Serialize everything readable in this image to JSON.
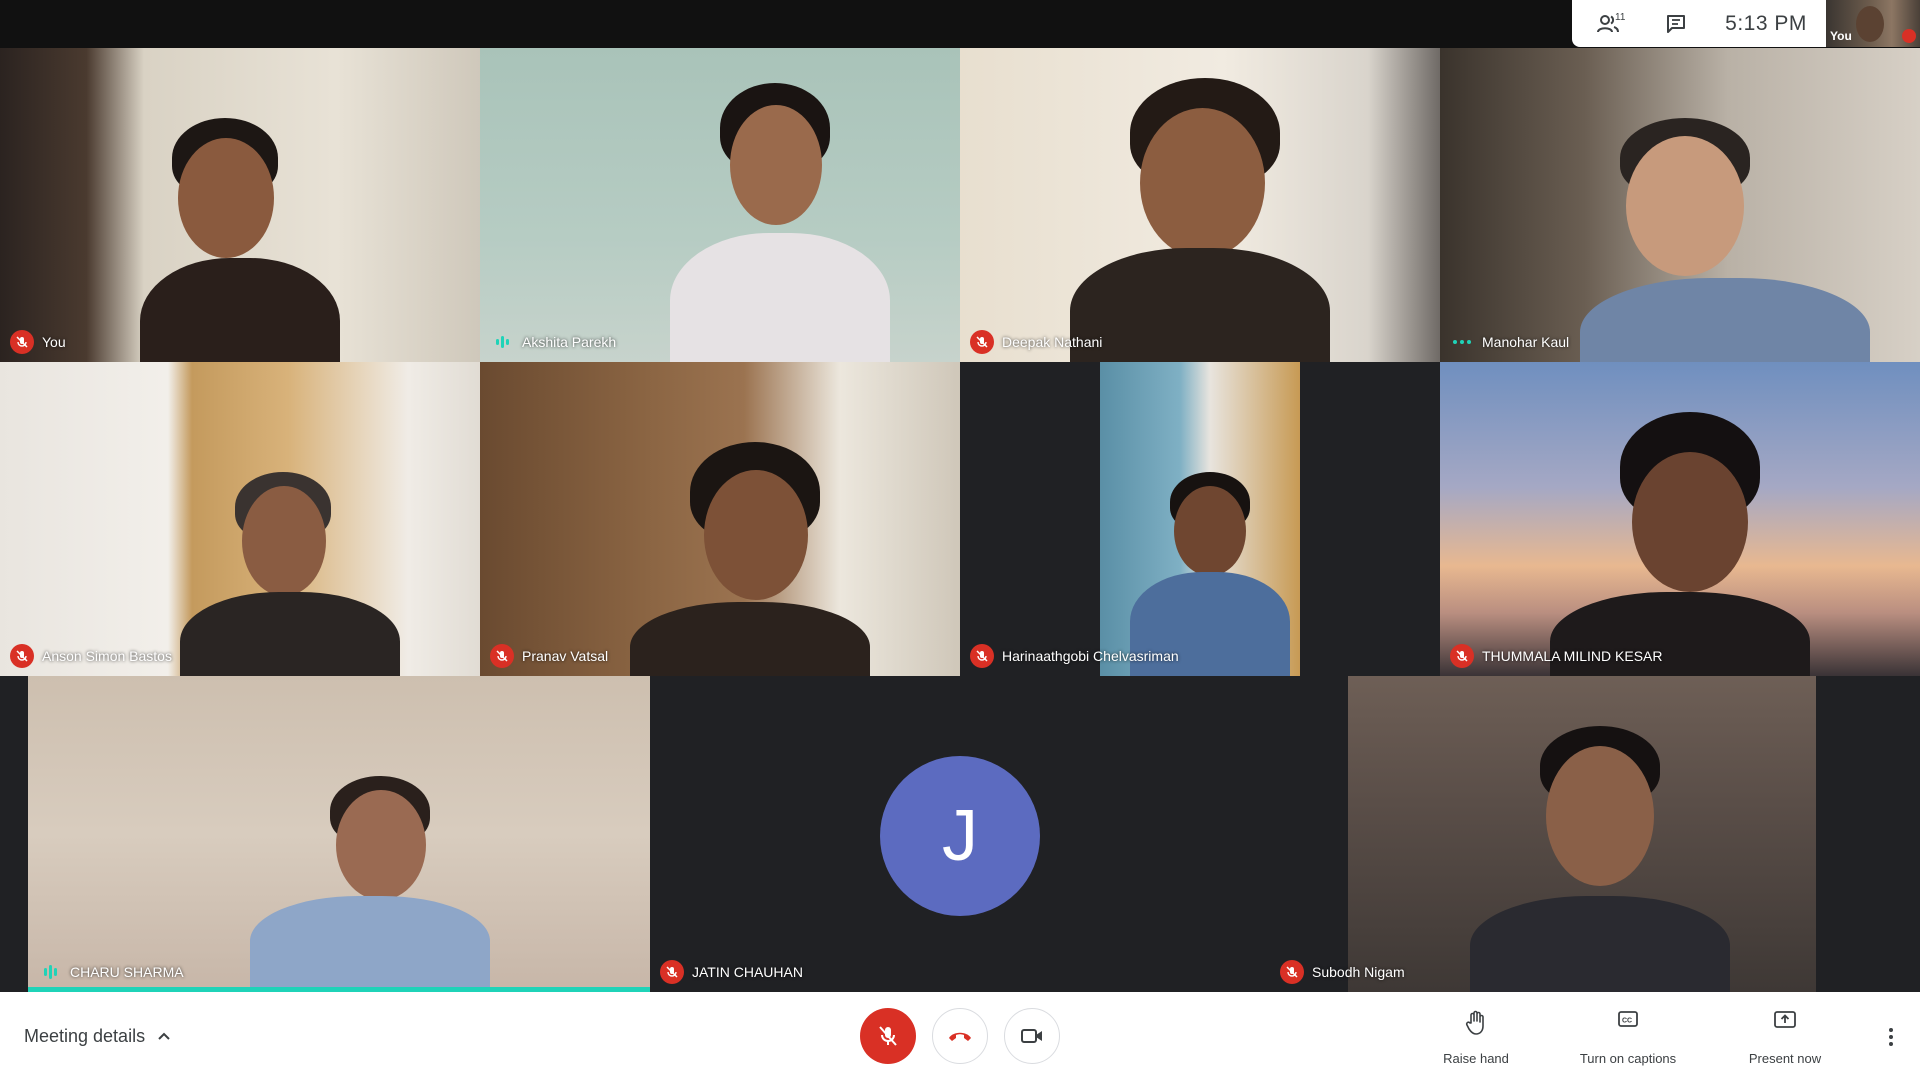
{
  "top_info": {
    "participant_count": "11",
    "time": "5:13 PM",
    "self_label": "You",
    "people_icon": "people-icon",
    "chat_icon": "chat-icon"
  },
  "participants": [
    {
      "name": "You",
      "status": "muted"
    },
    {
      "name": "Akshita Parekh",
      "status": "speaking"
    },
    {
      "name": "Deepak Nathani",
      "status": "muted"
    },
    {
      "name": "Manohar Kaul",
      "status": "unmuted"
    },
    {
      "name": "Anson Simon Bastos",
      "status": "muted"
    },
    {
      "name": "Pranav Vatsal",
      "status": "muted"
    },
    {
      "name": "Harinaathgobi Chelvasriman",
      "status": "muted"
    },
    {
      "name": "THUMMALA MILIND KESAR",
      "status": "muted"
    },
    {
      "name": "CHARU SHARMA",
      "status": "speaking"
    },
    {
      "name": "JATIN CHAUHAN",
      "status": "muted",
      "avatar_letter": "J"
    },
    {
      "name": "Subodh Nigam",
      "status": "muted"
    }
  ],
  "bottom_bar": {
    "meeting_details": "Meeting details",
    "raise_hand": "Raise hand",
    "captions": "Turn on captions",
    "present": "Present now"
  },
  "colors": {
    "mute_red": "#d93025",
    "speaking_teal": "#1fd3b8",
    "avatar_purple": "#5c6bc0",
    "stage_bg": "#202124"
  }
}
